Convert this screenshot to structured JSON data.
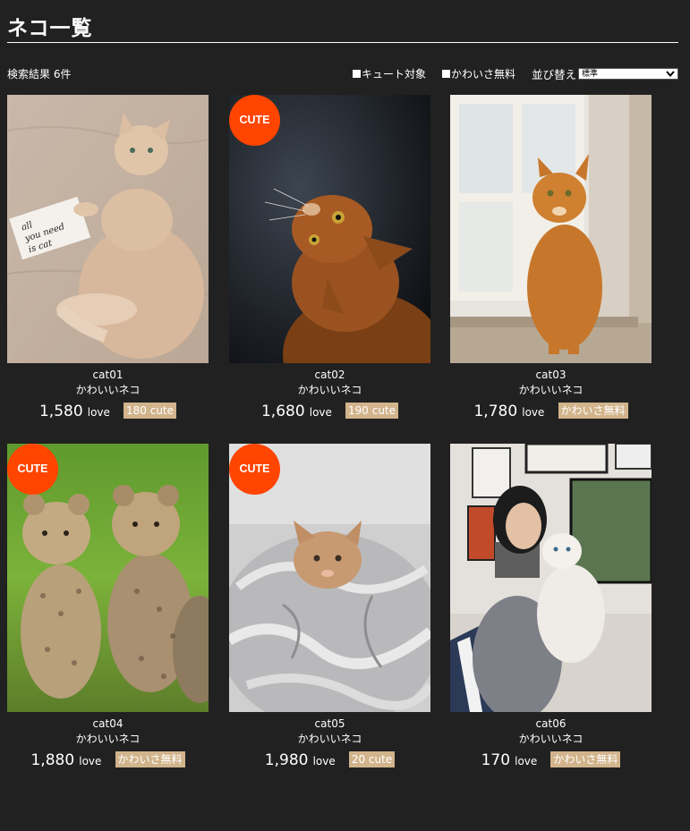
{
  "header": {
    "title": "ネコ一覧"
  },
  "toolbar": {
    "result_count": "検索結果 6件",
    "filter_cute": "キュート対象",
    "filter_free": "かわいさ無料",
    "sort_label": "並び替え",
    "sort_value": "標準"
  },
  "colors": {
    "background": "#212121",
    "badge": "#ff4500",
    "tag": "#d2b48c"
  },
  "cards": [
    {
      "id": "cat01",
      "desc": "かわいいネコ",
      "love": "1,580",
      "unit": "love",
      "tag": "180 cute",
      "badge": ""
    },
    {
      "id": "cat02",
      "desc": "かわいいネコ",
      "love": "1,680",
      "unit": "love",
      "tag": "190 cute",
      "badge": "CUTE"
    },
    {
      "id": "cat03",
      "desc": "かわいいネコ",
      "love": "1,780",
      "unit": "love",
      "tag": "かわいさ無料",
      "badge": ""
    },
    {
      "id": "cat04",
      "desc": "かわいいネコ",
      "love": "1,880",
      "unit": "love",
      "tag": "かわいさ無料",
      "badge": "CUTE"
    },
    {
      "id": "cat05",
      "desc": "かわいいネコ",
      "love": "1,980",
      "unit": "love",
      "tag": "20 cute",
      "badge": "CUTE"
    },
    {
      "id": "cat06",
      "desc": "かわいいネコ",
      "love": "170",
      "unit": "love",
      "tag": "かわいさ無料",
      "badge": ""
    }
  ]
}
